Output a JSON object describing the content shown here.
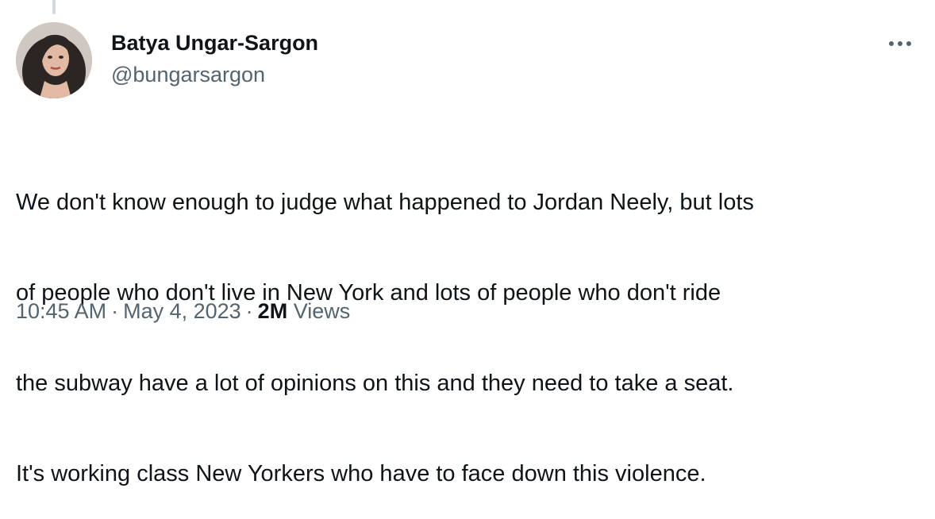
{
  "author": {
    "display_name": "Batya Ungar-Sargon",
    "handle": "@bungarsargon"
  },
  "tweet": {
    "text_lines": [
      "We don't know enough to judge what happened to Jordan Neely, but lots",
      "of people who don't live in New York and lots of people who don't ride",
      "the subway have a lot of opinions on this and they need to take a seat.",
      "It's working class New Yorkers who have to face down this violence."
    ]
  },
  "meta": {
    "time": "10:45 AM",
    "separator": "·",
    "date": "May 4, 2023",
    "views_count": "2M",
    "views_label": "Views"
  },
  "icons": {
    "more": "more-horizontal-icon",
    "avatar": "profile-photo"
  },
  "colors": {
    "text_primary": "#0f1419",
    "text_secondary": "#536471",
    "thread_line": "#cfd9de"
  }
}
